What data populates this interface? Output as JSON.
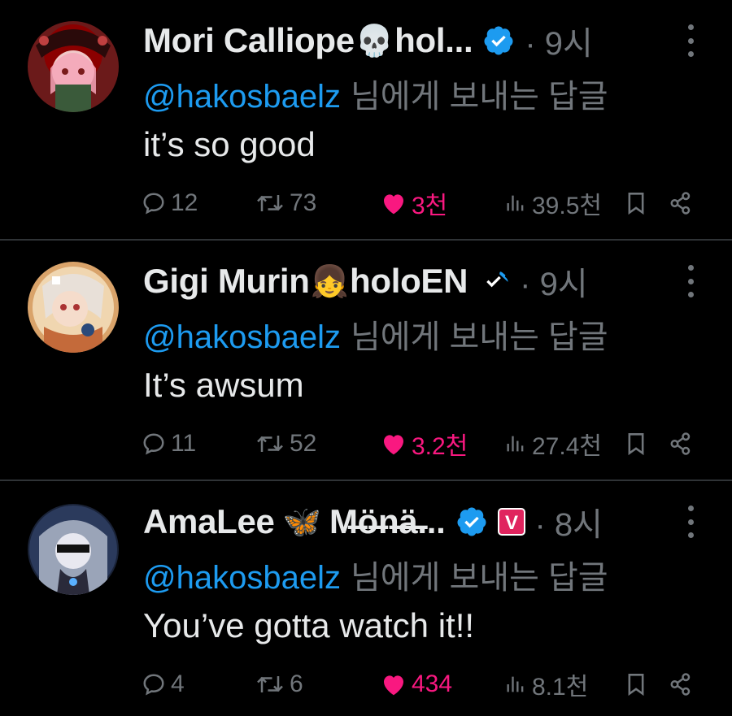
{
  "tweets": [
    {
      "name": "Mori Calliope",
      "emoji": "💀",
      "name_suffix": "hol...",
      "time": "· 9시",
      "mention": "@hakosbaelz",
      "reply_text": "님에게 보내는 답글",
      "body": "it’s so good",
      "replies": "12",
      "retweets": "73",
      "likes": "3천",
      "views": "39.5천",
      "avatar_icon": "mori-avatar"
    },
    {
      "name": "Gigi Murin",
      "emoji": "👧",
      "name_suffix": "holoEN",
      "time": "· 9시",
      "mention": "@hakosbaelz",
      "reply_text": "님에게 보내는 답글",
      "body": "It’s awsum",
      "replies": "11",
      "retweets": "52",
      "likes": "3.2천",
      "views": "27.4천",
      "avatar_icon": "gigi-avatar"
    },
    {
      "name": "AmaLee",
      "emoji": "🦋",
      "name_suffix": "M̶ö̶n̶ä̶...",
      "time": "· 8시",
      "mention": "@hakosbaelz",
      "reply_text": "님에게 보내는 답글",
      "body": "You’ve gotta watch it!!",
      "replies": "4",
      "retweets": "6",
      "likes": "434",
      "views": "8.1천",
      "avatar_icon": "amalee-avatar",
      "extra_badge": "V"
    }
  ],
  "colors": {
    "background": "#000000",
    "text": "#e7e9ea",
    "muted": "#71767b",
    "link": "#1d9bf0",
    "like": "#f91880",
    "divider": "#2f3336"
  }
}
